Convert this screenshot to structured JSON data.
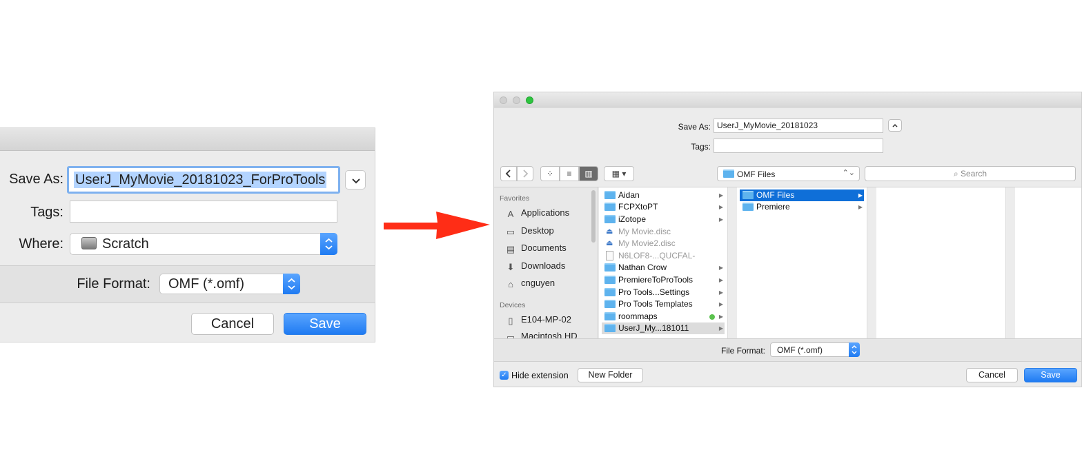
{
  "compact_dialog": {
    "save_as_label": "Save As:",
    "save_as_value": "UserJ_MyMovie_20181023_ForProTools",
    "tags_label": "Tags:",
    "tags_value": "",
    "where_label": "Where:",
    "where_value": "Scratch",
    "file_format_label": "File Format:",
    "file_format_value": "OMF (*.omf)",
    "cancel_label": "Cancel",
    "save_label": "Save"
  },
  "arrow_color": "#ff2d16",
  "expanded_dialog": {
    "save_as_label": "Save As:",
    "save_as_value": "UserJ_MyMovie_20181023",
    "tags_label": "Tags:",
    "location": "OMF Files",
    "search_placeholder": "Search",
    "sidebar": {
      "favorites_header": "Favorites",
      "favorites": [
        {
          "label": "Applications",
          "icon": "applications-icon"
        },
        {
          "label": "Desktop",
          "icon": "desktop-icon"
        },
        {
          "label": "Documents",
          "icon": "documents-icon"
        },
        {
          "label": "Downloads",
          "icon": "downloads-icon"
        },
        {
          "label": "cnguyen",
          "icon": "home-icon"
        }
      ],
      "devices_header": "Devices",
      "devices": [
        {
          "label": "E104-MP-02",
          "icon": "computer-icon"
        },
        {
          "label": "Macintosh HD",
          "icon": "disk-icon"
        }
      ]
    },
    "column1": [
      {
        "label": "Aidan",
        "kind": "folder"
      },
      {
        "label": "FCPXtoPT",
        "kind": "folder"
      },
      {
        "label": "iZotope",
        "kind": "folder"
      },
      {
        "label": "My Movie.disc",
        "kind": "disc"
      },
      {
        "label": "My Movie2.disc",
        "kind": "disc"
      },
      {
        "label": "N6LOF8-...QUCFAL-",
        "kind": "file"
      },
      {
        "label": "Nathan Crow",
        "kind": "folder"
      },
      {
        "label": "PremiereToProTools",
        "kind": "folder"
      },
      {
        "label": "Pro Tools...Settings",
        "kind": "folder"
      },
      {
        "label": "Pro Tools Templates",
        "kind": "folder"
      },
      {
        "label": "roommaps",
        "kind": "folder",
        "tag_color": "#5bc24e"
      },
      {
        "label": "UserJ_My...181011",
        "kind": "folder"
      }
    ],
    "column2": [
      {
        "label": "OMF Files",
        "kind": "folder",
        "selected": true
      },
      {
        "label": "Premiere",
        "kind": "folder"
      }
    ],
    "file_format_label": "File Format:",
    "file_format_value": "OMF (*.omf)",
    "hide_extension_label": "Hide extension",
    "hide_extension_checked": true,
    "new_folder_label": "New Folder",
    "cancel_label": "Cancel",
    "save_label": "Save"
  },
  "accent_color": "#1f7bf2"
}
